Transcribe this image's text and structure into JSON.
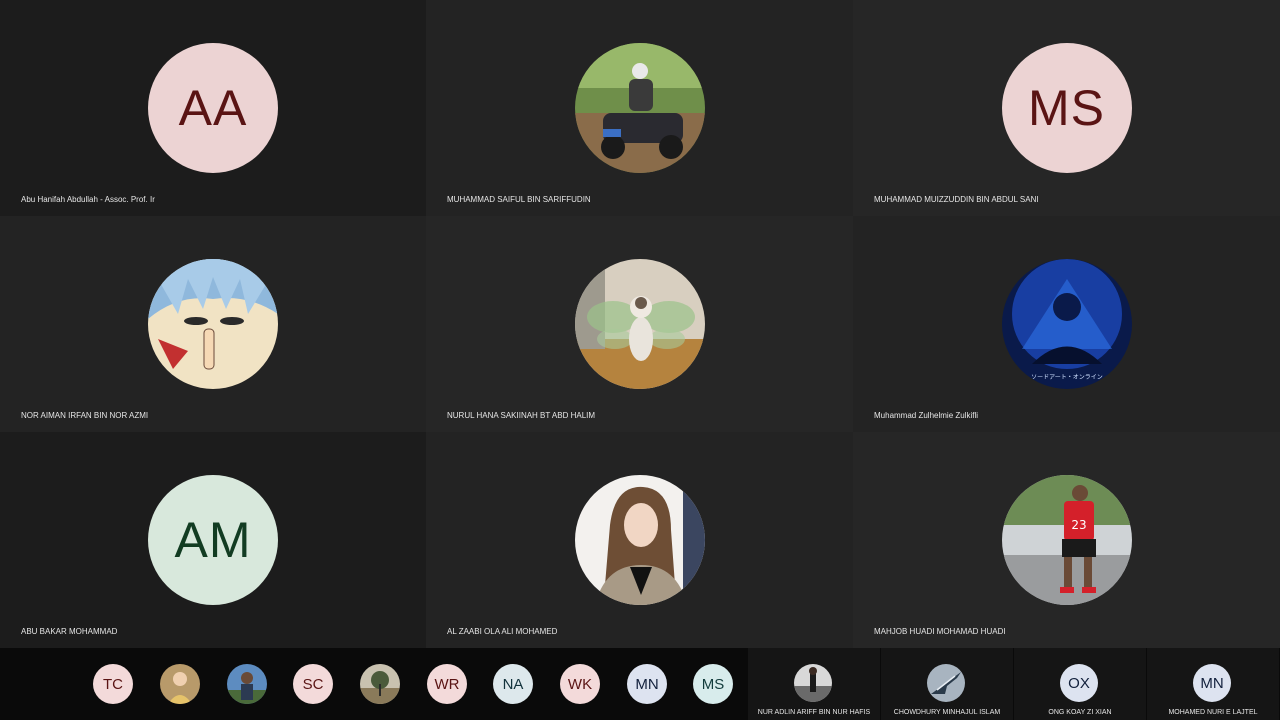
{
  "tiles": [
    {
      "name": "Abu Hanifah Abdullah - Assoc. Prof. Ir",
      "initials": "AA",
      "avatar_type": "initials",
      "bg": "#ecd3d3",
      "fg": "#5a1414"
    },
    {
      "name": "MUHAMMAD SAIFUL BIN SARIFFUDIN",
      "avatar_type": "photo",
      "icon": "atv-rider-photo"
    },
    {
      "name": "MUHAMMAD MUIZZUDDIN BIN ABDUL SANI",
      "initials": "MS",
      "avatar_type": "initials",
      "bg": "#ecd3d3",
      "fg": "#5a1414"
    },
    {
      "name": "NOR AIMAN IRFAN BIN NOR AZMI",
      "avatar_type": "photo",
      "icon": "anime-character-photo"
    },
    {
      "name": "NURUL HANA SAKIINAH BT ABD HALIM",
      "avatar_type": "photo",
      "icon": "fairy-cat-photo"
    },
    {
      "name": "Muhammad Zulhelmie Zulkifli",
      "avatar_type": "photo",
      "icon": "blue-anime-art-photo",
      "overlay_text": "ソードアート・オンライン"
    },
    {
      "name": "ABU BAKAR MOHAMMAD",
      "initials": "AM",
      "avatar_type": "initials",
      "bg": "#d8e8dc",
      "fg": "#123c22"
    },
    {
      "name": "AL ZAABI OLA ALI MOHAMED",
      "avatar_type": "photo",
      "icon": "woman-portrait-photo"
    },
    {
      "name": "MAHJOB HUADI MOHAMAD HUADI",
      "avatar_type": "photo",
      "icon": "basketball-jersey-photo",
      "overlay_text": "23"
    }
  ],
  "tray": [
    {
      "initials": "TC",
      "bg": "#f3dada",
      "fg": "#5a1414"
    },
    {
      "icon": "woman-photo"
    },
    {
      "icon": "man-outdoor-photo"
    },
    {
      "initials": "SC",
      "bg": "#f3dada",
      "fg": "#5a1414"
    },
    {
      "icon": "landscape-photo"
    },
    {
      "initials": "WR",
      "bg": "#f3dada",
      "fg": "#5a1414"
    },
    {
      "initials": "NA",
      "bg": "#dde8ec",
      "fg": "#12323c"
    },
    {
      "initials": "WK",
      "bg": "#f3dada",
      "fg": "#5a1414"
    },
    {
      "initials": "MN",
      "bg": "#dde3f0",
      "fg": "#12203c"
    },
    {
      "initials": "MS",
      "bg": "#d8ecec",
      "fg": "#123c3c"
    }
  ],
  "named_tray": [
    {
      "name": "NUR ADLIN ARIFF BIN NUR HAFIS",
      "icon": "street-photo"
    },
    {
      "name": "CHOWDHURY MINHAJUL ISLAM",
      "icon": "jet-photo"
    },
    {
      "name": "ONG KOAY ZI XIAN",
      "initials": "OX",
      "bg": "#dde3f0",
      "fg": "#12203c"
    },
    {
      "name": "MOHAMED NURI E LAJTEL",
      "initials": "MN",
      "bg": "#dde3f0",
      "fg": "#12203c"
    }
  ]
}
